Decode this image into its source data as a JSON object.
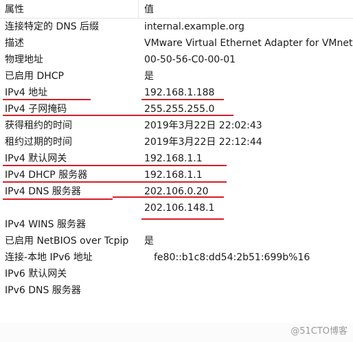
{
  "table": {
    "header": {
      "property": "属性",
      "value": "值"
    },
    "rows": [
      {
        "property": "连接特定的 DNS 后缀",
        "value": "internal.example.org"
      },
      {
        "property": "描述",
        "value": "VMware Virtual Ethernet Adapter for VMnet"
      },
      {
        "property": "物理地址",
        "value": "00-50-56-C0-00-01"
      },
      {
        "property": "已启用 DHCP",
        "value": "是"
      },
      {
        "property": "IPv4 地址",
        "value": "192.168.1.188"
      },
      {
        "property": "IPv4 子网掩码",
        "value": "255.255.255.0"
      },
      {
        "property": "获得租约的时间",
        "value": "2019年3月22日 22:02:43"
      },
      {
        "property": "租约过期的时间",
        "value": "2019年3月22日 22:12:44"
      },
      {
        "property": "IPv4 默认网关",
        "value": "192.168.1.1"
      },
      {
        "property": "IPv4 DHCP 服务器",
        "value": "192.168.1.1"
      },
      {
        "property": "IPv4 DNS 服务器",
        "value": "202.106.0.20"
      },
      {
        "property": "",
        "value": "202.106.148.1"
      },
      {
        "property": "IPv4 WINS 服务器",
        "value": ""
      },
      {
        "property": "已启用 NetBIOS over Tcpip",
        "value": "是"
      },
      {
        "property": "连接-本地 IPv6 地址",
        "value": "fe80::b1c8:dd54:2b51:699b%16"
      },
      {
        "property": "IPv6 默认网关",
        "value": ""
      },
      {
        "property": "IPv6 DNS 服务器",
        "value": ""
      }
    ]
  },
  "annotation_color": "#d81e2a",
  "watermark": "@51CTO博客"
}
